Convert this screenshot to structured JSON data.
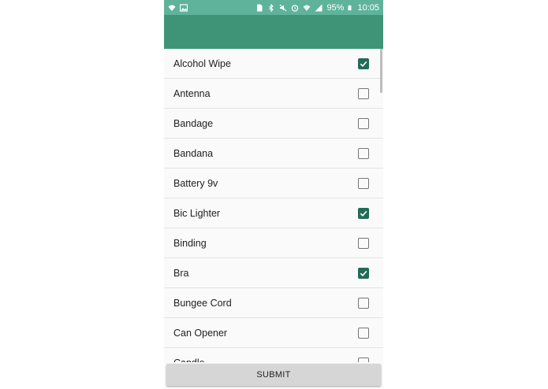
{
  "status_bar": {
    "battery_percent": "95%",
    "time": "10:05",
    "left_icons": [
      "wifi-icon",
      "image-icon"
    ],
    "right_icons": [
      "sim-icon",
      "bluetooth-icon",
      "mute-icon",
      "alarm-icon",
      "wifi-signal-icon",
      "cell-signal-icon",
      "battery-icon"
    ]
  },
  "colors": {
    "status_bar": "#5fb39a",
    "app_bar": "#3f9478",
    "checkbox_checked": "#236b57"
  },
  "items": [
    {
      "label": "Alcohol Wipe",
      "checked": true
    },
    {
      "label": "Antenna",
      "checked": false
    },
    {
      "label": "Bandage",
      "checked": false
    },
    {
      "label": "Bandana",
      "checked": false
    },
    {
      "label": "Battery 9v",
      "checked": false
    },
    {
      "label": "Bic Lighter",
      "checked": true
    },
    {
      "label": "Binding",
      "checked": false
    },
    {
      "label": "Bra",
      "checked": true
    },
    {
      "label": "Bungee Cord",
      "checked": false
    },
    {
      "label": "Can Opener",
      "checked": false
    },
    {
      "label": "Candle",
      "checked": false
    }
  ],
  "submit_label": "SUBMIT"
}
